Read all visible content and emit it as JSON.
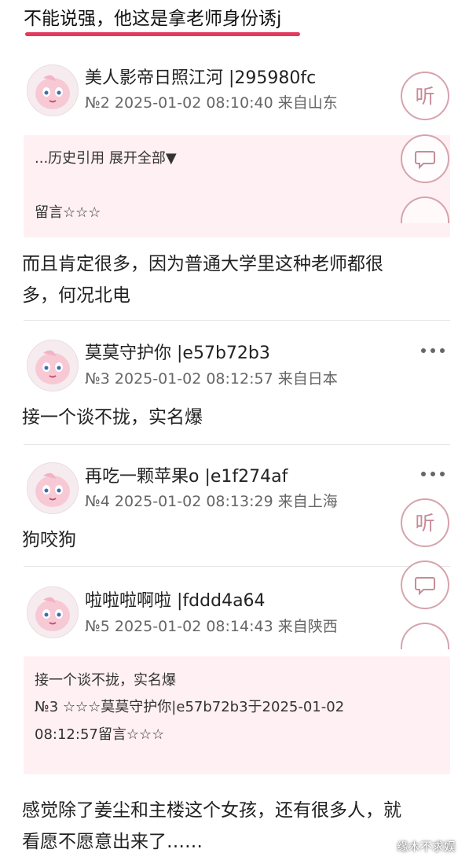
{
  "top_text": "不能说强，他这是拿老师身份诱j",
  "posts": [
    {
      "username": "美人影帝日照江河",
      "uid": "|295980fc",
      "meta": "№2 2025-01-02 08:10:40 来自山东",
      "quote": {
        "lines": [
          "...历史引用 展开全部▼",
          "留言☆☆☆"
        ]
      },
      "body_lines": [
        "而且肯定很多，因为普通大学里这种老师都很",
        "多，何况北电"
      ]
    },
    {
      "username": "莫莫守护你",
      "uid": "|e57b72b3",
      "meta": "№3 2025-01-02 08:12:57 来自日本",
      "body_lines": [
        "接一个谈不拢，实名爆"
      ]
    },
    {
      "username": "再吃一颗苹果o",
      "uid": "|e1f274af",
      "meta": "№4 2025-01-02 08:13:29 来自上海",
      "body_lines": [
        "狗咬狗"
      ]
    },
    {
      "username": "啦啦啦啊啦",
      "uid": "|fddd4a64",
      "meta": "№5 2025-01-02 08:14:43 来自陕西",
      "quote": {
        "lines": [
          "接一个谈不拢，实名爆",
          "№3 ☆☆☆莫莫守护你|e57b72b3于2025-01-02",
          "08:12:57留言☆☆☆"
        ]
      },
      "body_lines": [
        "感觉除了姜尘和主楼这个女孩，还有很多人，就",
        "看愿不愿意出来了……"
      ]
    }
  ],
  "floating": {
    "listen_label": "听"
  },
  "watermark": "缘木不求娱",
  "colors": {
    "accent_underline": "#e23a5c",
    "quote_bg": "#fff0f3",
    "fab_border": "#d6a3ad"
  }
}
